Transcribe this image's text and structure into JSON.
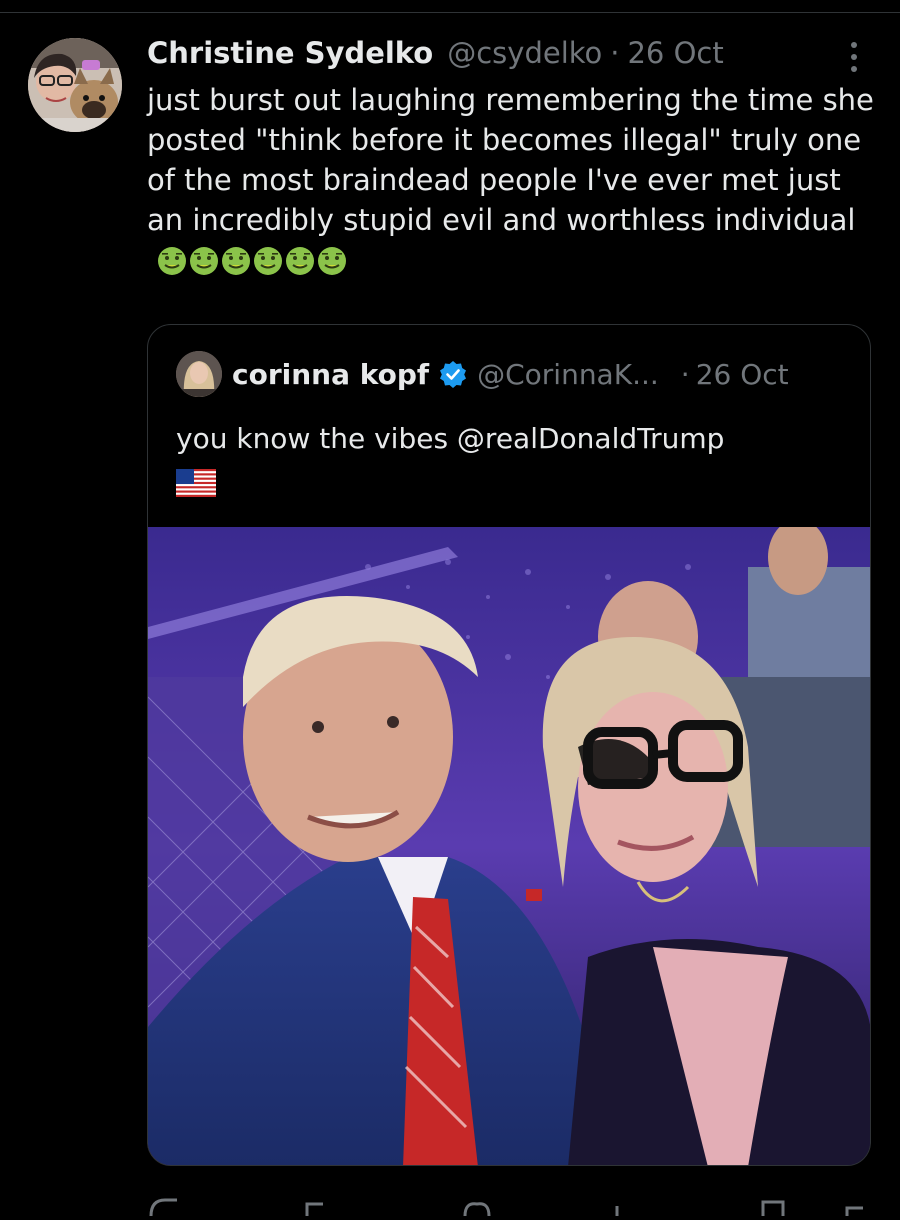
{
  "tweet": {
    "author": {
      "display_name": "Christine Sydelko",
      "handle": "@csydelko",
      "avatar_icon": "profile-photo-with-dog"
    },
    "separator": "·",
    "timestamp": "26 Oct",
    "text": "just burst out laughing remembering the time she posted \"think before it becomes illegal\" truly one of the most braindead people I've ever met just an incredibly stupid evil and worthless individual",
    "emojis": [
      "nauseated-face",
      "nauseated-face",
      "nauseated-face",
      "nauseated-face",
      "nauseated-face",
      "nauseated-face"
    ],
    "more_icon": "vertical-ellipsis-icon"
  },
  "quoted_tweet": {
    "author": {
      "display_name": "corinna kopf",
      "handle": "@CorinnaK...",
      "verified": true,
      "avatar_icon": "profile-photo"
    },
    "separator": "·",
    "timestamp": "26 Oct",
    "text": "you know the vibes @realDonaldTrump",
    "flag_icon": "us-flag-icon",
    "media": {
      "type": "photo",
      "description_icon": "selfie-at-arena-photo"
    }
  },
  "colors": {
    "background": "#000000",
    "primary_text": "#e7e9ea",
    "secondary_text": "#71767b",
    "border": "#2f3336",
    "verified_blue": "#1d9bf0"
  }
}
